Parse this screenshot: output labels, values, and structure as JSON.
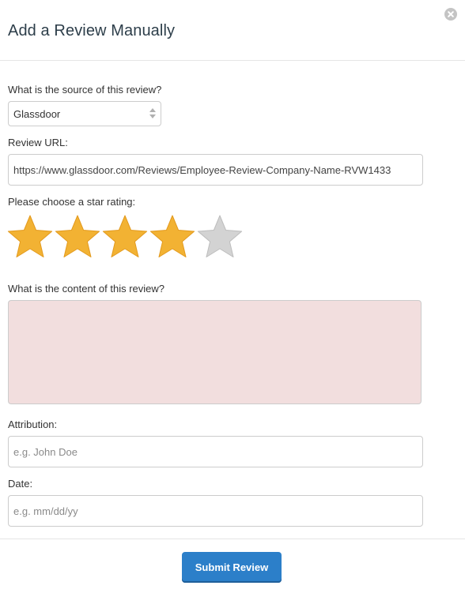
{
  "modal": {
    "title": "Add a Review Manually",
    "close_icon": "close-icon"
  },
  "form": {
    "source": {
      "label": "What is the source of this review?",
      "selected": "Glassdoor"
    },
    "url": {
      "label": "Review URL:",
      "value": "https://www.glassdoor.com/Reviews/Employee-Review-Company-Name-RVW1433"
    },
    "rating": {
      "label": "Please choose a star rating:",
      "value": 4,
      "max": 5,
      "filled_color": "#f2b233",
      "empty_color": "#d3d3d3"
    },
    "content": {
      "label": "What is the content of this review?",
      "value": "",
      "error_bg": "#f2dede"
    },
    "attribution": {
      "label": "Attribution:",
      "placeholder": "e.g. John Doe"
    },
    "date": {
      "label": "Date:",
      "placeholder": "e.g. mm/dd/yy"
    }
  },
  "footer": {
    "submit_label": "Submit Review",
    "accent": "#2c7fc9"
  }
}
